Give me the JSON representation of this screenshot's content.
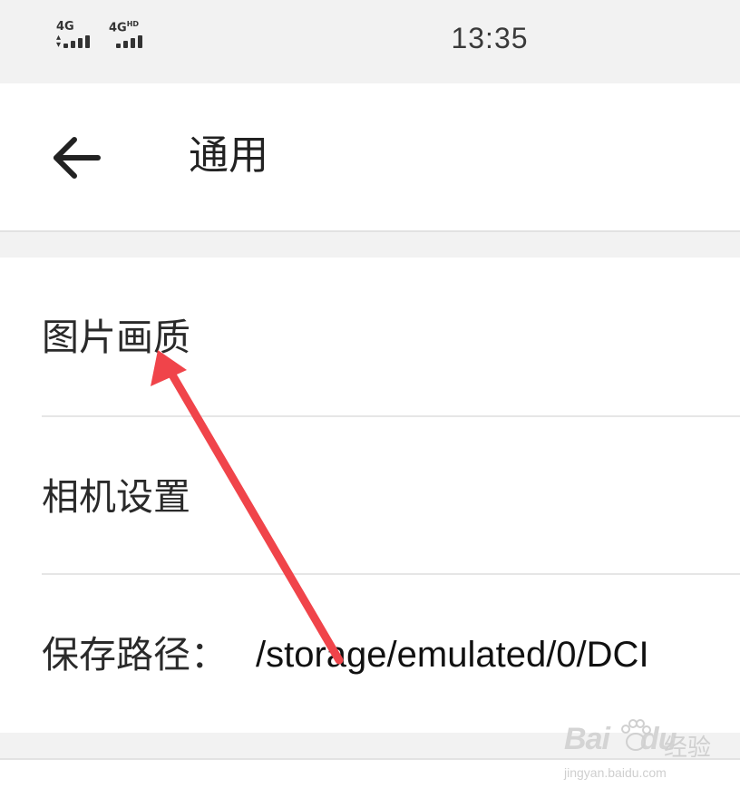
{
  "status_bar": {
    "network_1": "4G",
    "network_2": "4G",
    "network_2_suffix": "HD",
    "time": "13:35"
  },
  "header": {
    "back_icon": "arrow-left-icon",
    "title": "通用"
  },
  "settings": {
    "items": [
      {
        "label": "图片画质",
        "value": ""
      },
      {
        "label": "相机设置",
        "value": ""
      },
      {
        "label": "保存路径：",
        "value": "/storage/emulated/0/DCI"
      }
    ]
  },
  "annotation": {
    "arrow_color": "#f0444a"
  },
  "watermark": {
    "brand": "Bai",
    "brand_suffix": "du",
    "brand_cn": "经验",
    "url": "jingyan.baidu.com"
  }
}
